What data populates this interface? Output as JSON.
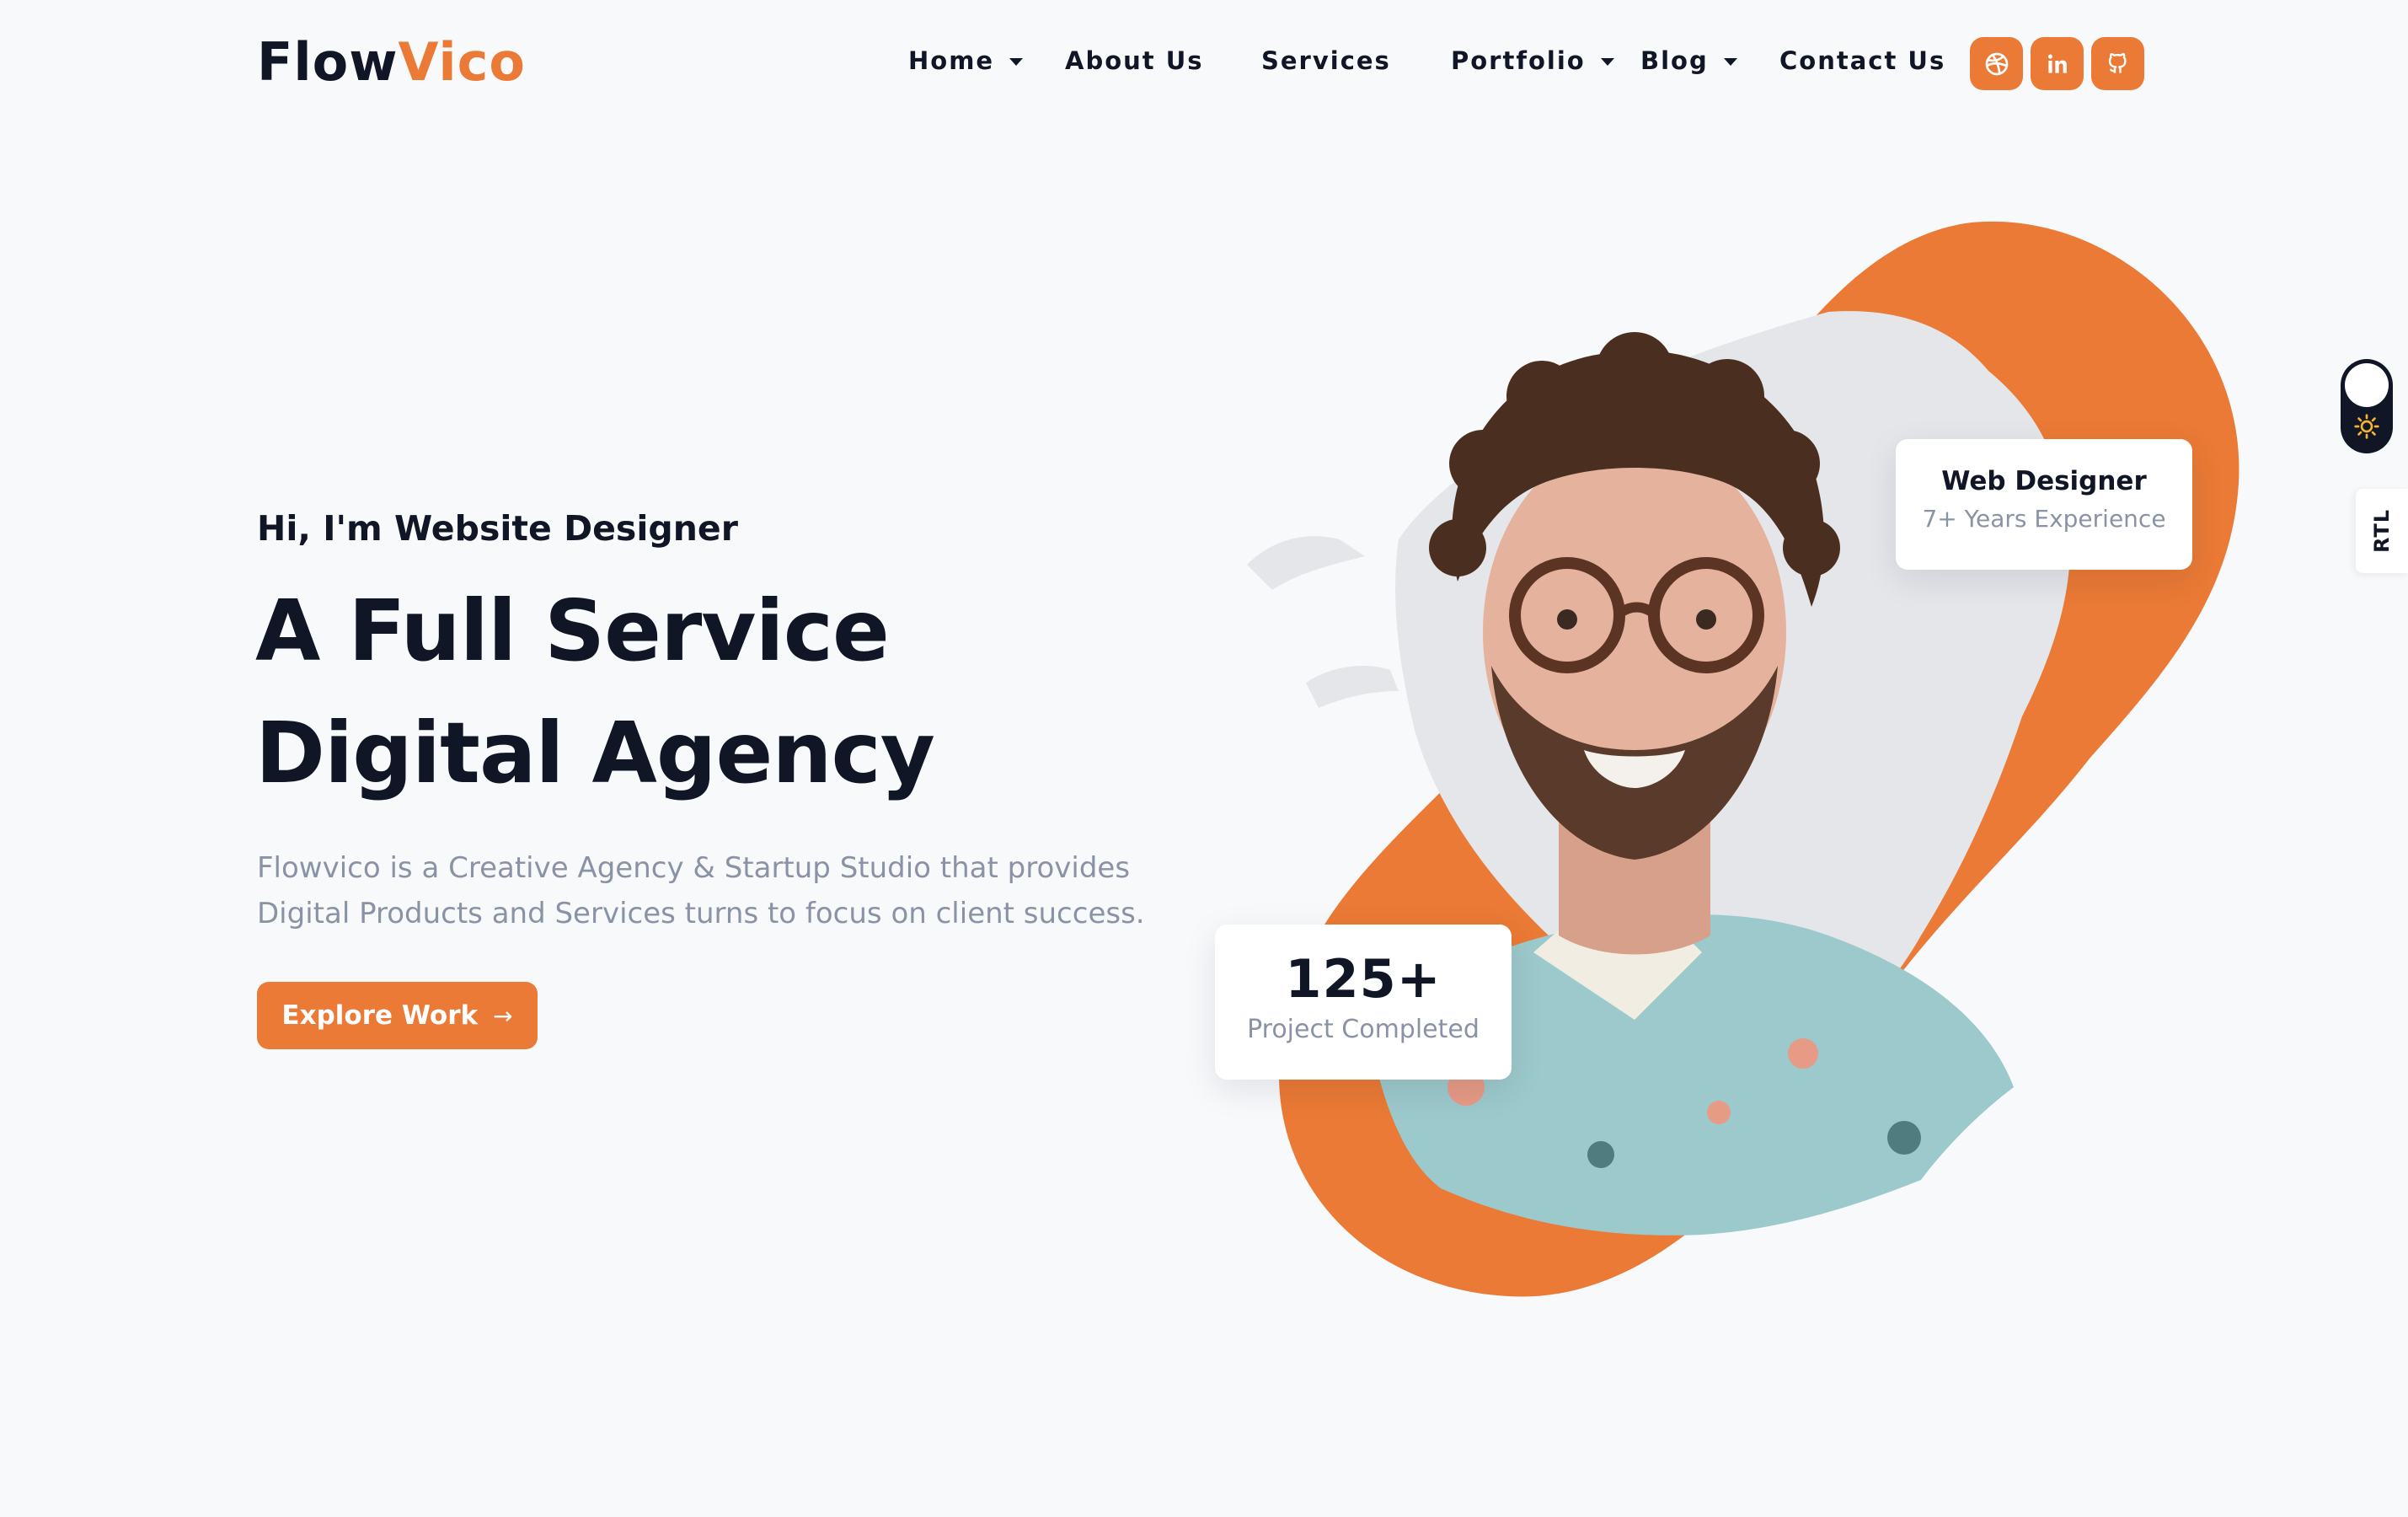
{
  "brand": {
    "logo_part1": "Flow",
    "logo_part2": "Vico",
    "accent_color": "#ea7a35",
    "dark_color": "#101626"
  },
  "nav": {
    "items": [
      {
        "label": "Home",
        "has_dropdown": true
      },
      {
        "label": "About Us",
        "has_dropdown": false
      },
      {
        "label": "Services",
        "has_dropdown": false
      },
      {
        "label": "Portfolio",
        "has_dropdown": true
      },
      {
        "label": "Blog",
        "has_dropdown": true
      },
      {
        "label": "Contact Us",
        "has_dropdown": false
      }
    ],
    "social": [
      "dribbble-icon",
      "linkedin-icon",
      "github-icon"
    ]
  },
  "hero": {
    "greeting": "Hi, I'm Website Designer",
    "headline_line1": "A Full Service",
    "headline_line2": "Digital Agency",
    "description": "Flowvico is a Creative Agency & Startup Studio that provides Digital Products and Services turns to focus on client success.",
    "cta_label": "Explore Work",
    "cta_icon": "arrow-right-icon"
  },
  "cards": {
    "designer": {
      "title": "Web Designer",
      "subtitle": "7+ Years Experience"
    },
    "projects": {
      "count": "125+",
      "label": "Project Completed"
    }
  },
  "controls": {
    "theme_icon": "sun-icon",
    "rtl_label": "RTL"
  }
}
